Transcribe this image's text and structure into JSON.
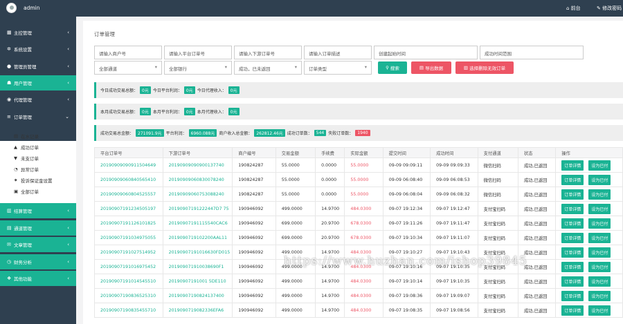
{
  "topbar": {
    "user": "admin",
    "home": "前台",
    "password": "修改密码"
  },
  "sidebar": {
    "items": [
      {
        "label": "主控管理",
        "icon": "dashboard-icon"
      },
      {
        "label": "系统设置",
        "icon": "settings-icon"
      },
      {
        "label": "管理员管理",
        "icon": "user-icon"
      },
      {
        "label": "用户管理",
        "icon": "users-icon"
      },
      {
        "label": "代理管理",
        "icon": "eye-icon"
      },
      {
        "label": "订单管理",
        "icon": "list-icon"
      },
      {
        "label": "结算管理",
        "icon": "doc-icon"
      },
      {
        "label": "通道管理",
        "icon": "channel-icon"
      },
      {
        "label": "文章管理",
        "icon": "article-icon"
      },
      {
        "label": "财务分析",
        "icon": "chart-icon"
      },
      {
        "label": "其他功能",
        "icon": "other-icon"
      }
    ],
    "submenu": [
      "在水记录",
      "成功订单",
      "未支订单",
      "异常订单",
      "投诉保证金设置",
      "全部订单"
    ]
  },
  "page": {
    "title": "订单管理"
  },
  "filters": {
    "row1": [
      "请输入商户号",
      "请输入平台订单号",
      "请输入下游订单号",
      "请输入订单描述",
      "创建起始时间",
      "成功时间范围"
    ],
    "row2": [
      "全部通道",
      "全部银行",
      "成功，已未返回",
      "订单类型"
    ],
    "search": "搜索",
    "export": "导出数据",
    "delete": "选择删除无效订单"
  },
  "stats": {
    "row1": [
      {
        "label": "今日成功交易总额：",
        "value": "0元"
      },
      {
        "label": "今日平台利润：",
        "value": "0元"
      },
      {
        "label": "今日代理收入：",
        "value": "0元"
      }
    ],
    "row2": [
      {
        "label": "本月成功交易总额：",
        "value": "0元"
      },
      {
        "label": "本月平台利润：",
        "value": "0元"
      },
      {
        "label": "本月代理收入：",
        "value": "0元"
      }
    ],
    "row3": [
      {
        "label": "成功交易总金额：",
        "value": "271091.9元"
      },
      {
        "label": "平台利润：",
        "value": "6960.088元"
      },
      {
        "label": "商户收入总金额：",
        "value": "262812.46元"
      },
      {
        "label": "成功订单数：",
        "value": "544"
      },
      {
        "label": "失败订单数：",
        "value": "1940"
      }
    ]
  },
  "table": {
    "headers": [
      "平台订单号",
      "下游订单号",
      "商户编号",
      "交易金额",
      "手续费",
      "实际金额",
      "提交时间",
      "成功时间",
      "支付通道",
      "状态",
      "操作"
    ],
    "rows": [
      [
        "20190909090911504649",
        "20190909090900137740",
        "190824287",
        "55.0000",
        "0.0000",
        "55.0000",
        "09-09 09:09:11",
        "09-09 09:09:33",
        "微信扫码",
        "成功,已返回"
      ],
      [
        "20190909060840565410",
        "20190909060830078240",
        "190824287",
        "55.0000",
        "0.0000",
        "55.0000",
        "09-09 06:08:40",
        "09-09 06:08:53",
        "微信扫码",
        "成功,已返回"
      ],
      [
        "20190909060804525557",
        "20190909060753088240",
        "190824287",
        "55.0000",
        "0.0000",
        "55.0000",
        "09-09 06:08:04",
        "09-09 06:08:32",
        "微信扫码",
        "成功,已返回"
      ],
      [
        "20190907191234505197",
        "20190907191222447D7 75",
        "190946092",
        "499.0000",
        "14.9700",
        "484.0300",
        "09-07 19:12:34",
        "09-07 19:12:47",
        "支付宝扫码",
        "成功,已返回"
      ],
      [
        "20190907191126101825",
        "20190907191115540CAC6",
        "190946092",
        "699.0000",
        "20.9700",
        "678.0300",
        "09-07 19:11:26",
        "09-07 19:11:47",
        "支付宝扫码",
        "成功,已返回"
      ],
      [
        "20190907191034975055",
        "2019090719102200AAL11",
        "190946092",
        "699.0000",
        "20.9700",
        "678.0300",
        "09-07 19:10:34",
        "09-07 19:11:07",
        "支付宝扫码",
        "成功,已返回"
      ],
      [
        "20190907191027514952",
        "20190907191016630FD015",
        "190946092",
        "499.0000",
        "14.9700",
        "484.0300",
        "09-07 19:10:27",
        "09-07 19:10:43",
        "支付宝扫码",
        "成功,已返回"
      ],
      [
        "20190907191016975452",
        "201909071910038690F1",
        "190946092",
        "499.0000",
        "14.9700",
        "484.0300",
        "09-07 19:10:16",
        "09-07 19:10:35",
        "支付宝扫码",
        "成功,已返回"
      ],
      [
        "20190907191014545510",
        "20190907191001 5DE110",
        "190946092",
        "499.0000",
        "14.9700",
        "484.0300",
        "09-07 19:10:14",
        "09-07 19:10:35",
        "支付宝扫码",
        "成功,已返回"
      ],
      [
        "20190907190836525310",
        "20190907190824137400",
        "190946092",
        "499.0000",
        "14.9700",
        "484.0300",
        "09-07 19:08:36",
        "09-07 19:09:07",
        "支付宝扫码",
        "成功,已返回"
      ],
      [
        "20190907190835455710",
        "2019090719082336EFA6",
        "190946092",
        "499.0000",
        "14.9700",
        "484.0300",
        "09-07 19:08:35",
        "09-07 19:08:56",
        "支付宝扫码",
        "成功,已返回"
      ]
    ],
    "actions": [
      "订单详情",
      "设为已付"
    ]
  },
  "watermark": "https://www.huzhan.com/ishop39845"
}
